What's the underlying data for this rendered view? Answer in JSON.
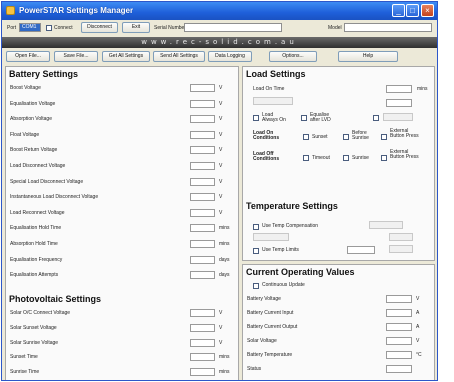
{
  "window": {
    "title": "PowerSTAR Settings Manager",
    "controls": [
      "_",
      "□",
      "×"
    ]
  },
  "portbar": {
    "port_label": "Port",
    "port_value": "COM1",
    "connect_label": "Connect",
    "disconnect_label": "Disconnect",
    "exit_label": "Exit",
    "serial_label": "Serial Number",
    "serial_value": "",
    "model_label": "Model",
    "model_value": ""
  },
  "banner": "www.rec-solid.com.au",
  "toolbar": [
    "Open File...",
    "Save File...",
    "Get All Settings",
    "Send All Settings",
    "Data Logging",
    "Options...",
    "Help"
  ],
  "battery": {
    "title": "Battery Settings",
    "rows": [
      {
        "label": "Boost Voltage",
        "unit": "V"
      },
      {
        "label": "Equalisation Voltage",
        "unit": "V"
      },
      {
        "label": "Absorption Voltage",
        "unit": "V"
      },
      {
        "label": "Float Voltage",
        "unit": "V"
      },
      {
        "label": "Boost Return Voltage",
        "unit": "V"
      },
      {
        "label": "Load Disconnect Voltage",
        "unit": "V"
      },
      {
        "label": "Special Load Disconnect Voltage",
        "unit": "V"
      },
      {
        "label": "Instantaneous Load Disconnect Voltage",
        "unit": "V"
      },
      {
        "label": "Load Reconnect Voltage",
        "unit": "V"
      },
      {
        "label": "Equalisation Hold Time",
        "unit": "mins"
      },
      {
        "label": "Absorption Hold Time",
        "unit": "mins"
      },
      {
        "label": "Equalisation Frequency",
        "unit": "days"
      },
      {
        "label": "Equalisation Attempts",
        "unit": "days"
      }
    ]
  },
  "pv": {
    "title": "Photovoltaic Settings",
    "rows": [
      {
        "label": "Solar O/C Connect Voltage",
        "unit": "V"
      },
      {
        "label": "Solar Sunset Voltage",
        "unit": "V"
      },
      {
        "label": "Solar Sunrise Voltage",
        "unit": "V"
      },
      {
        "label": "Sunset Time",
        "unit": "mins"
      },
      {
        "label": "Sunrise Time",
        "unit": "mins"
      }
    ]
  },
  "load": {
    "title": "Load Settings",
    "load_on_time_label": "Load On Time",
    "load_on_time_unit": "mins",
    "load_always_on": "Load Always On",
    "equalise_after_lvd": "Equalise after LVD",
    "third_option": "",
    "on_conditions_label": "Load On Conditions",
    "off_conditions_label": "Load Off Conditions",
    "on_options": [
      "Sunset",
      "Before Sunrise",
      "External Button Press"
    ],
    "off_options": [
      "Timeout",
      "Sunrise",
      "External Button Press"
    ]
  },
  "temp": {
    "title": "Temperature Settings",
    "use_temp_compensation": "Use Temp Compensation",
    "use_temp_limits": "Use Temp Limits"
  },
  "current": {
    "title": "Current Operating Values",
    "continuous_update": "Continuous Update",
    "rows": [
      {
        "label": "Battery Voltage",
        "unit": "V"
      },
      {
        "label": "Battery Current Input",
        "unit": "A"
      },
      {
        "label": "Battery Current Output",
        "unit": "A"
      },
      {
        "label": "Solar Voltage",
        "unit": "V"
      },
      {
        "label": "Battery Temperature",
        "unit": "°C"
      },
      {
        "label": "Status",
        "unit": ""
      }
    ]
  }
}
